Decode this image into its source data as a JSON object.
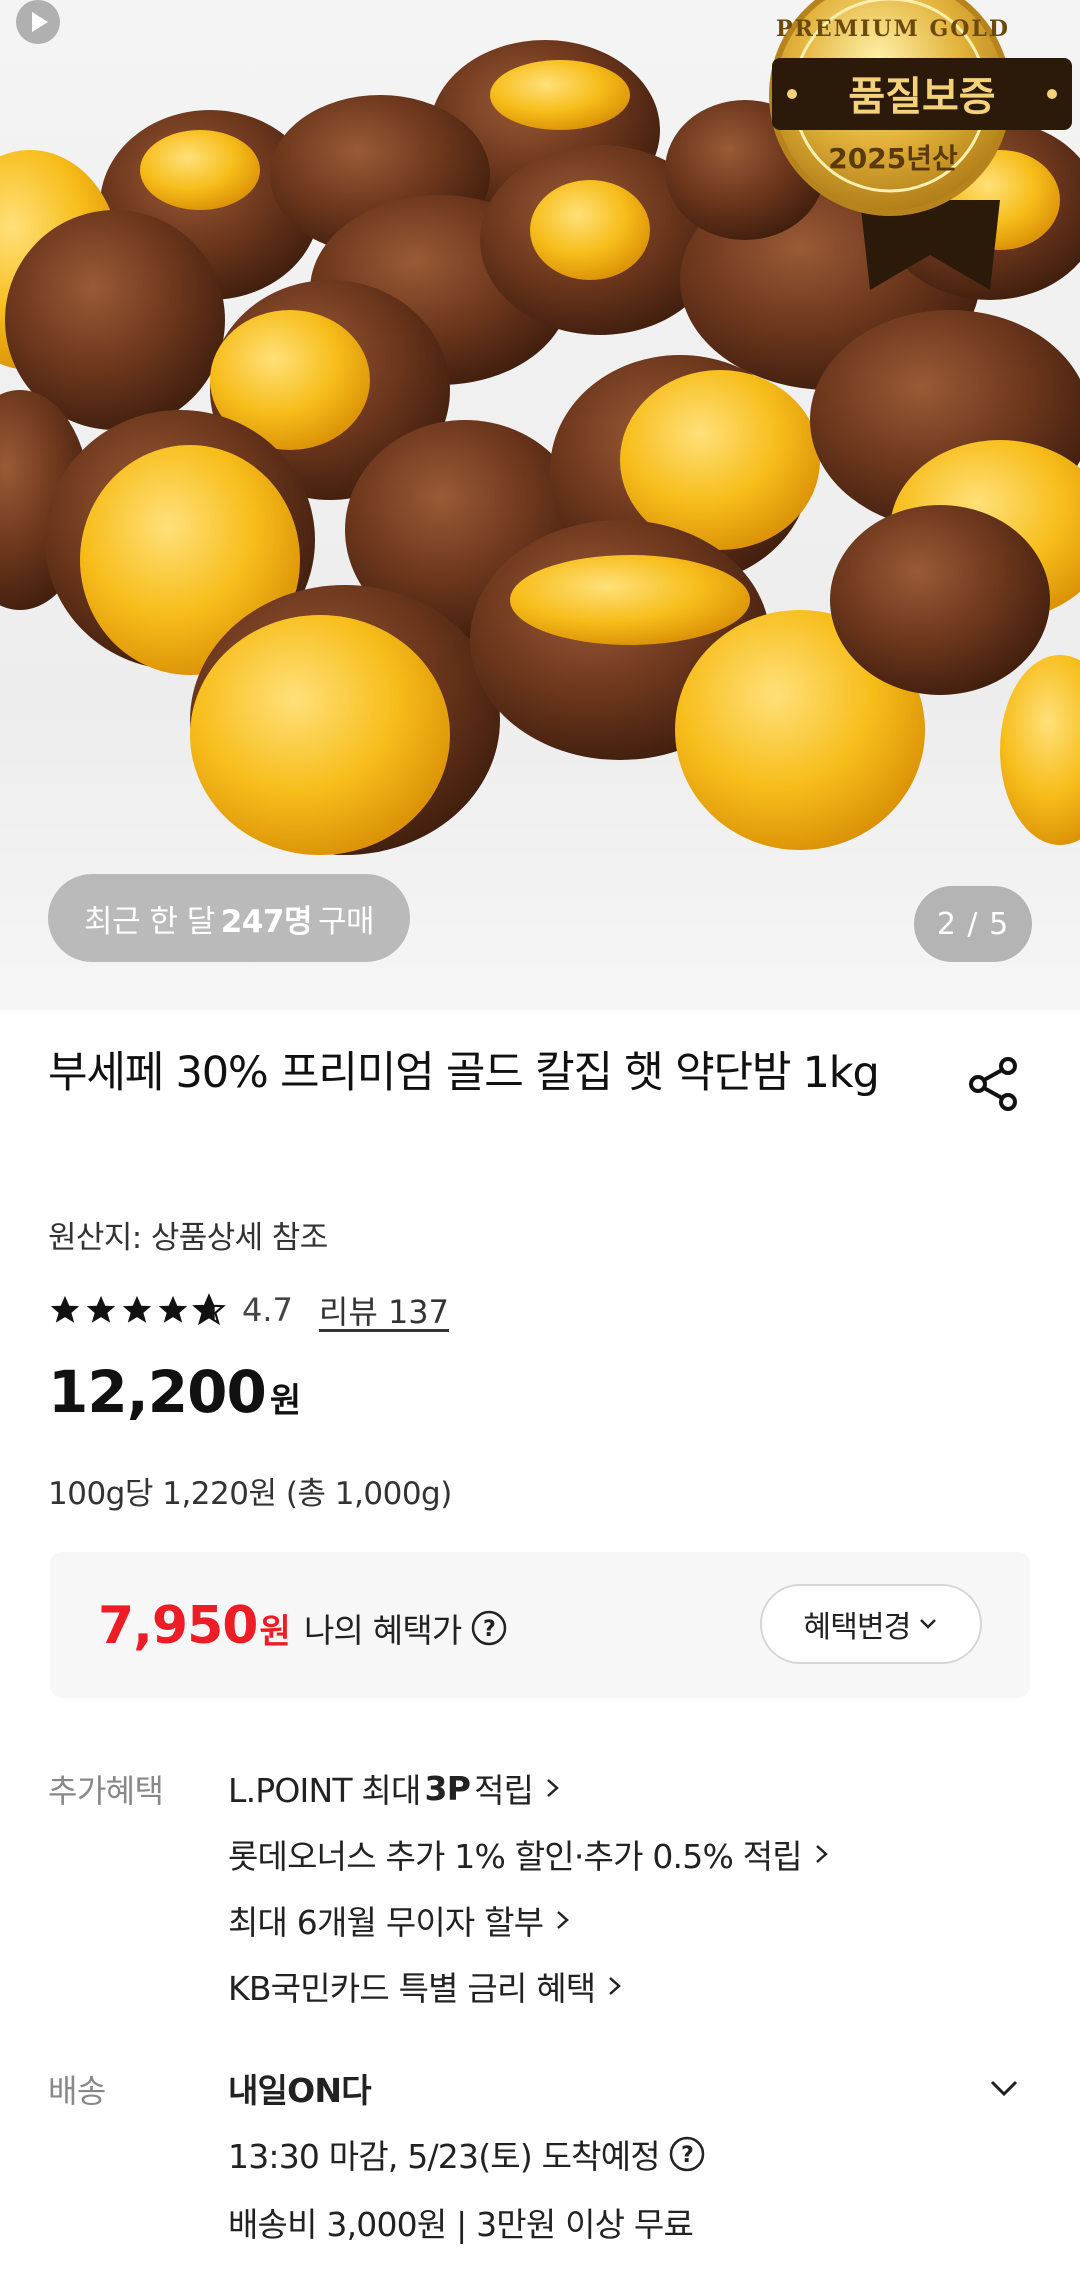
{
  "hero": {
    "badge_top": "PREMIUM GOLD",
    "badge_main": "품질보증",
    "badge_year": "2025년산",
    "purchase_prefix": "최근 한 달",
    "purchase_count": "247명",
    "purchase_suffix": "구매",
    "counter": "2 / 5"
  },
  "product": {
    "title": "부세페 30% 프리미엄 골드 칼집 햇 약단밤 1kg",
    "origin": "원산지: 상품상세 참조",
    "rating": "4.7",
    "rating_value": 4.7,
    "review_link": "리뷰 137",
    "price": "12,200",
    "price_unit": "원",
    "unit_price": "100g당 1,220원 (총 1,000g)"
  },
  "benefit": {
    "price": "7,950",
    "price_unit": "원",
    "label": "나의 혜택가",
    "change_button": "혜택변경"
  },
  "extra": {
    "label": "추가혜택",
    "lines": [
      {
        "pre": "L.POINT 최대",
        "bold": "3P",
        "post": "적립"
      },
      {
        "text": "롯데오너스 추가 1% 할인·추가 0.5% 적립"
      },
      {
        "text": "최대 6개월 무이자 할부"
      },
      {
        "text": "KB국민카드 특별 금리 혜택"
      }
    ]
  },
  "shipping": {
    "label": "배송",
    "title": "내일ON다",
    "eta": "13:30 마감, 5/23(토) 도착예정",
    "fee": "배송비 3,000원 | 3만원 이상 무료"
  },
  "colors": {
    "accent_red": "#ee1c25",
    "gold": "#d9a62a",
    "chestnut_yellow": "#f5b60f",
    "shell_brown": "#5a2e18"
  }
}
